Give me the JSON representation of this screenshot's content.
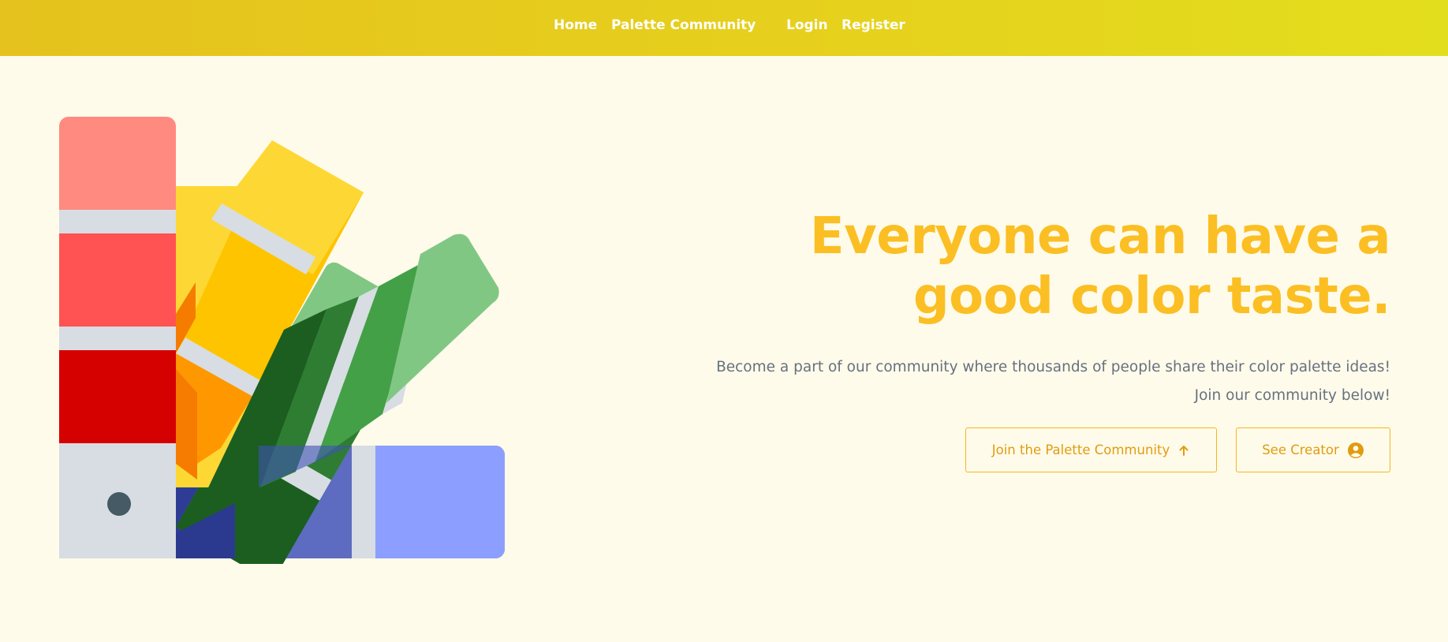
{
  "nav": {
    "home_label": "Home",
    "community_label": "Palette Community",
    "login_label": "Login",
    "register_label": "Register"
  },
  "hero": {
    "headline": "Everyone can have a good color taste.",
    "subtext_line1": "Become a part of our community where thousands of people share their color palette ideas!",
    "subtext_line2": "Join our community below!",
    "join_button_label": "Join the Palette Community",
    "join_button_icon": "arrow-up-icon",
    "creator_button_label": "See Creator",
    "creator_button_icon": "user-circle-icon",
    "illustration_icon": "color-swatch-fan-icon"
  },
  "colors": {
    "navbar": "#e6cc1d",
    "background": "#fffbea",
    "headline": "#fbbf24",
    "button_border": "#f5b61c",
    "button_text": "#e09c10",
    "subtext": "#66717f"
  }
}
